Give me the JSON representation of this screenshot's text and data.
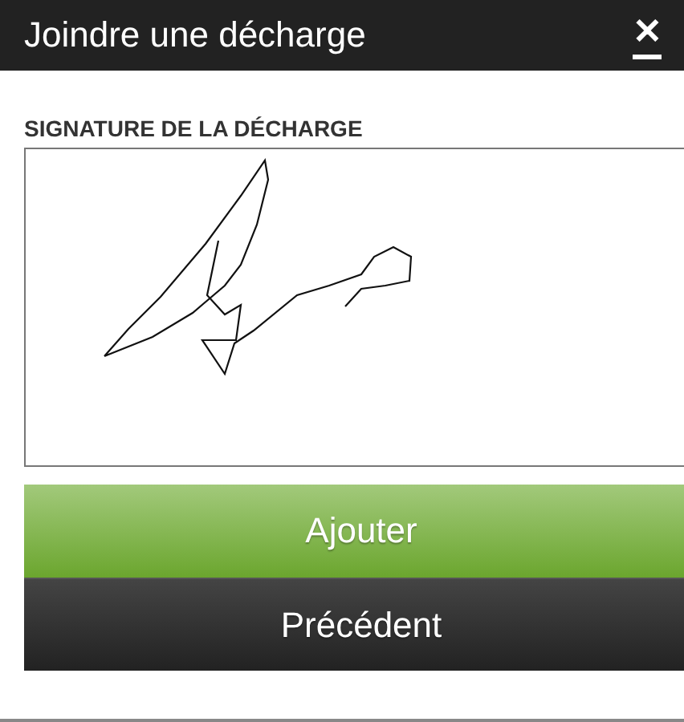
{
  "dialog": {
    "title": "Joindre une décharge",
    "close": "✕"
  },
  "signature": {
    "label": "SIGNATURE DE LA DÉCHARGE"
  },
  "buttons": [
    {
      "label": "Ajouter",
      "kind": "primary"
    },
    {
      "label": "Précédent",
      "kind": "secondary"
    }
  ]
}
